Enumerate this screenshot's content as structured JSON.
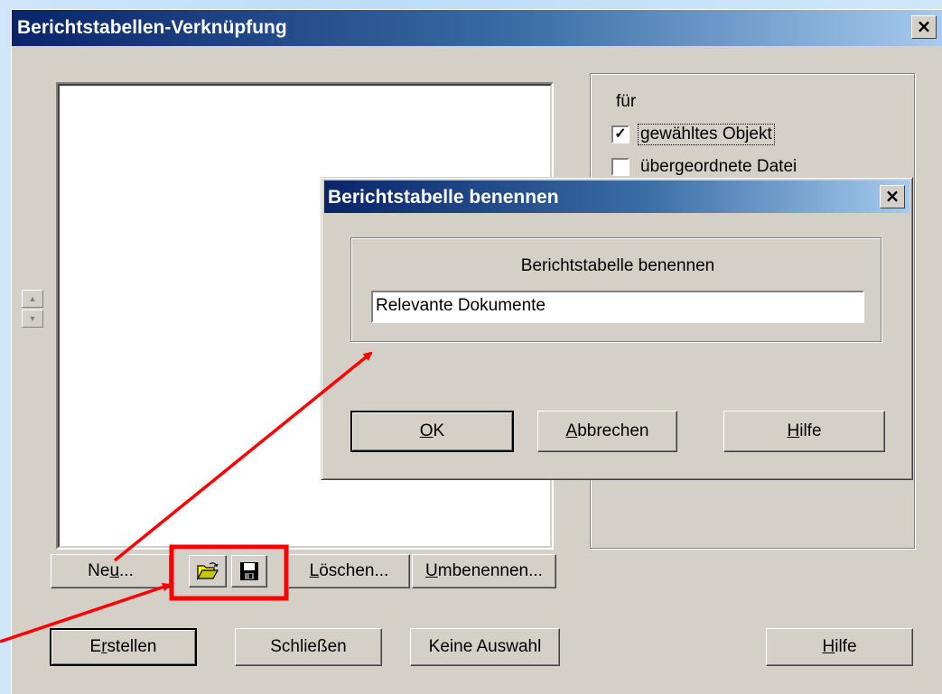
{
  "main_window": {
    "title": "Berichtstabellen-Verknüpfung",
    "close_glyph": "×",
    "options": {
      "group_label": "für",
      "checkboxes": [
        {
          "label": "gewähltes Objekt",
          "checked": true
        },
        {
          "label": "übergeordnete Datei",
          "checked": false
        }
      ]
    },
    "list_buttons": {
      "new_prefix": "Ne",
      "new_accel": "u",
      "new_suffix": "...",
      "delete_accel": "L",
      "delete_rest": "öschen...",
      "rename_accel": "U",
      "rename_rest": "mbenennen..."
    },
    "bottom_buttons": {
      "create_prefix": "E",
      "create_accel": "r",
      "create_rest": "stellen",
      "close_label": "Schließen",
      "no_selection_label": "Keine Auswahl",
      "help_accel": "H",
      "help_rest": "ilfe"
    }
  },
  "name_dialog": {
    "title": "Berichtstabelle benennen",
    "close_glyph": "×",
    "group_label": "Berichtstabelle benennen",
    "input_value": "Relevante Dokumente",
    "ok_accel": "O",
    "ok_rest": "K",
    "cancel_accel": "A",
    "cancel_rest": "bbrechen",
    "help_accel": "H",
    "help_rest": "ilfe"
  },
  "annotation": {
    "color": "#ff0000"
  },
  "icons": [
    "open-folder-icon",
    "save-disk-icon",
    "scroll-up-icon",
    "scroll-down-icon",
    "check-icon",
    "close-icon"
  ]
}
